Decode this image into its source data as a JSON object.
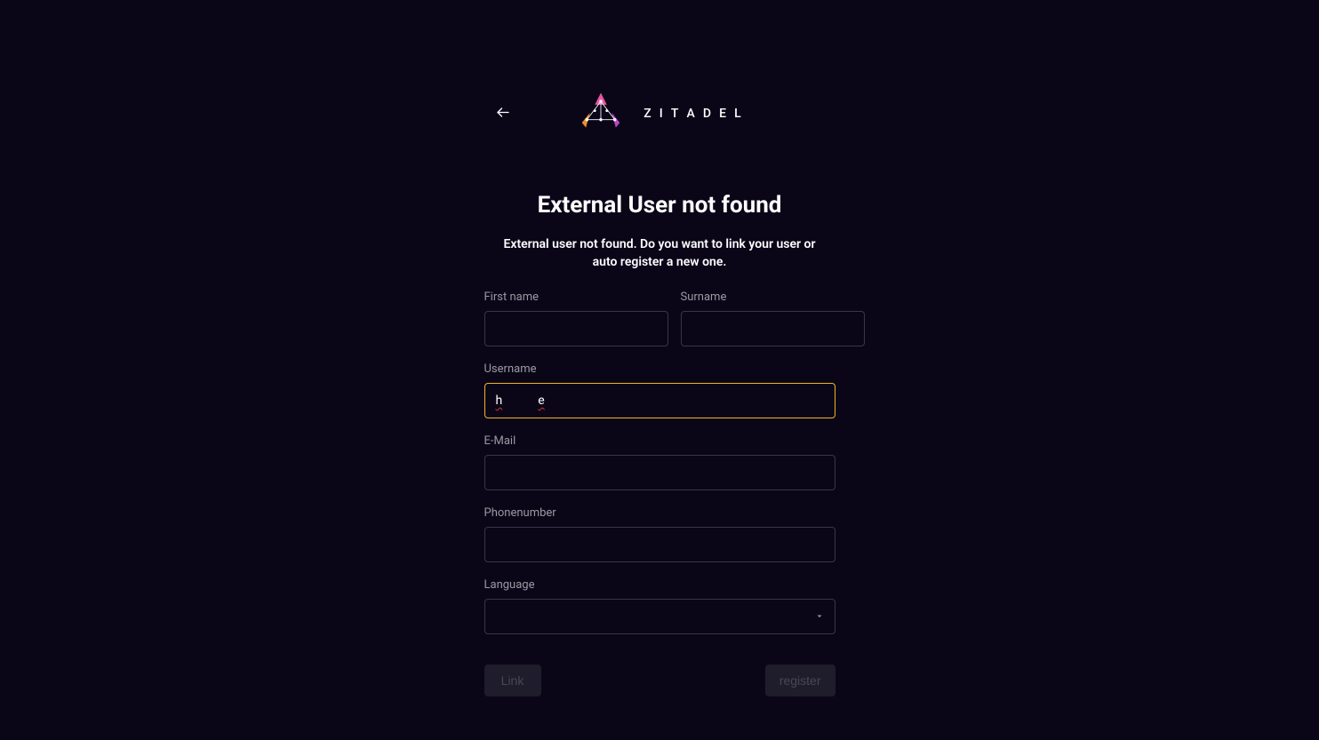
{
  "brand": {
    "name": "ZITADEL",
    "letters": [
      "Z",
      "I",
      "T",
      "A",
      "D",
      "E",
      "L"
    ]
  },
  "page": {
    "title": "External User not found",
    "subtitle": "External user not found. Do you want to link your user or auto register a new one."
  },
  "form": {
    "firstname": {
      "label": "First name",
      "value": ""
    },
    "surname": {
      "label": "Surname",
      "value": ""
    },
    "username": {
      "label": "Username",
      "value_part1": "h",
      "value_part2": "e"
    },
    "email": {
      "label": "E-Mail",
      "value": ""
    },
    "phone": {
      "label": "Phonenumber",
      "value": ""
    },
    "language": {
      "label": "Language",
      "value": ""
    }
  },
  "actions": {
    "link": "Link",
    "register": "register"
  }
}
